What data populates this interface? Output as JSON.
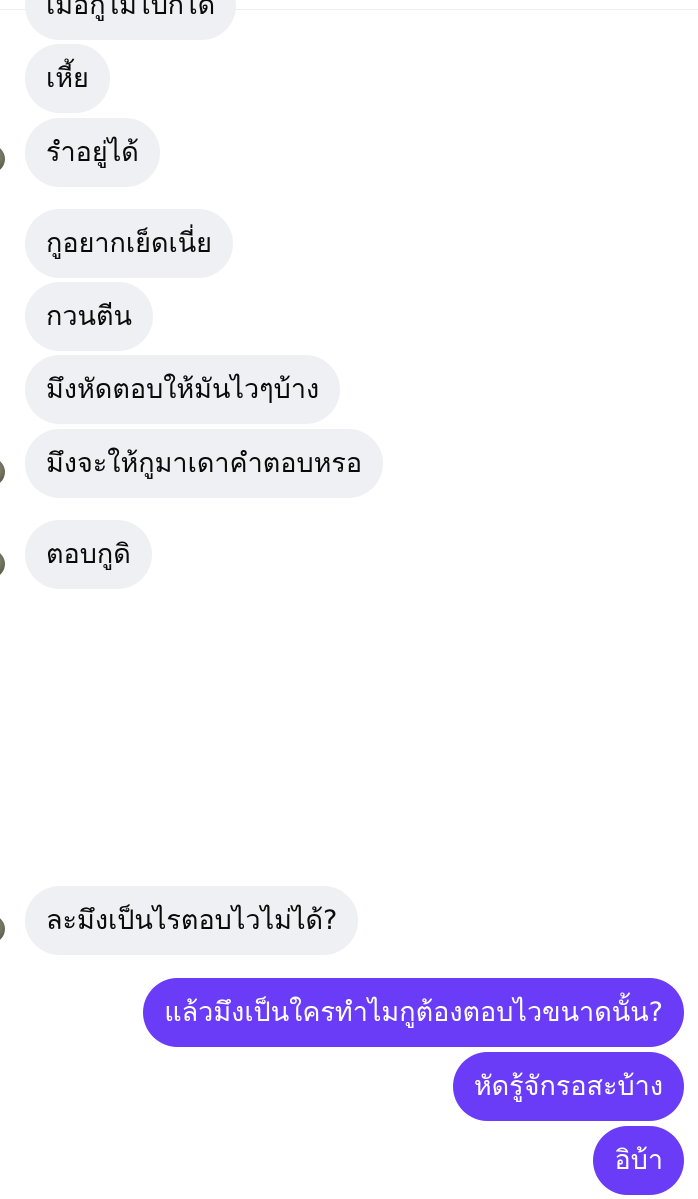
{
  "chat": {
    "incoming": [
      "เมื่อกูไม่ไปก็ได้",
      "เหี้ย",
      "รำอยู่ได้",
      "กูอยากเย็ดเนี่ย",
      "กวนตีน",
      "มึงหัดตอบให้มันไวๆบ้าง",
      "มึงจะให้กูมาเดาคำตอบหรอ",
      "ตอบกูดิ",
      "ละมึงเป็นไรตอบไวไม่ได้?"
    ],
    "outgoing": [
      "แล้วมึงเป็นใครทำไมกูต้องตอบไวขนาดนั้น?",
      "หัดรู้จักรอสะบ้าง",
      "อิบ้า"
    ]
  },
  "colors": {
    "incoming_bubble": "#eef0f3",
    "outgoing_bubble": "#6a3cf7",
    "outgoing_text": "#ffffff"
  },
  "icons": [
    "contact-avatar-icon"
  ]
}
